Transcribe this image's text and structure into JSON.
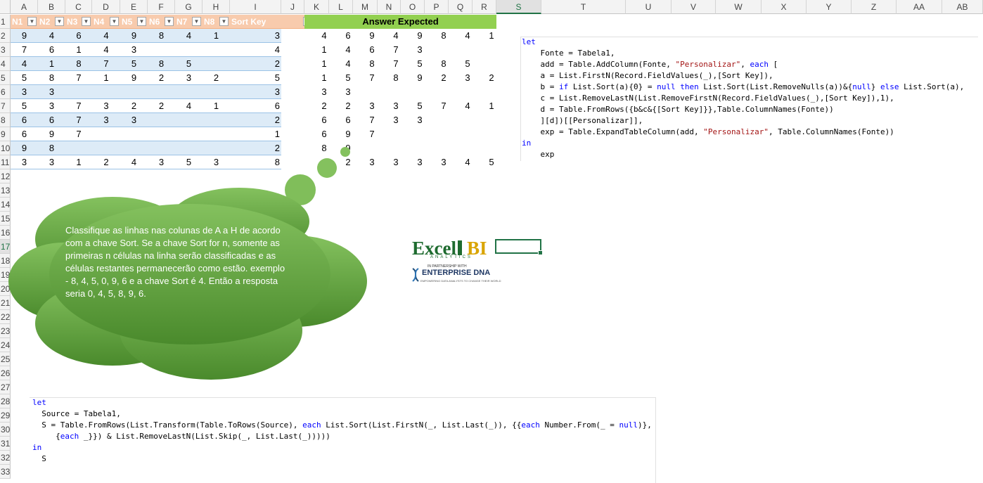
{
  "columns": [
    "A",
    "B",
    "C",
    "D",
    "E",
    "F",
    "G",
    "H",
    "I",
    "J",
    "K",
    "L",
    "M",
    "N",
    "O",
    "P",
    "Q",
    "R",
    "S",
    "T",
    "U",
    "V",
    "W",
    "X",
    "Y",
    "Z",
    "AA",
    "AB"
  ],
  "rows": [
    "1",
    "2",
    "3",
    "4",
    "5",
    "6",
    "7",
    "8",
    "9",
    "10",
    "11",
    "12",
    "13",
    "14",
    "15",
    "16",
    "17",
    "18",
    "19",
    "20",
    "21",
    "22",
    "23",
    "24",
    "25",
    "26",
    "27",
    "28",
    "29",
    "30",
    "31",
    "32",
    "33"
  ],
  "table": {
    "headers": [
      "N1",
      "N2",
      "N3",
      "N4",
      "N5",
      "N6",
      "N7",
      "N8",
      "Sort Key"
    ],
    "rows": [
      [
        "9",
        "4",
        "6",
        "4",
        "9",
        "8",
        "4",
        "1",
        "3"
      ],
      [
        "7",
        "6",
        "1",
        "4",
        "3",
        "",
        "",
        "",
        "4"
      ],
      [
        "4",
        "1",
        "8",
        "7",
        "5",
        "8",
        "5",
        "",
        "2"
      ],
      [
        "5",
        "8",
        "7",
        "1",
        "9",
        "2",
        "3",
        "2",
        "5"
      ],
      [
        "3",
        "3",
        "",
        "",
        "",
        "",
        "",
        "",
        "3"
      ],
      [
        "5",
        "3",
        "7",
        "3",
        "2",
        "2",
        "4",
        "1",
        "6"
      ],
      [
        "6",
        "6",
        "7",
        "3",
        "3",
        "",
        "",
        "",
        "2"
      ],
      [
        "6",
        "9",
        "7",
        "",
        "",
        "",
        "",
        "",
        "1"
      ],
      [
        "9",
        "8",
        "",
        "",
        "",
        "",
        "",
        "",
        "2"
      ],
      [
        "3",
        "3",
        "1",
        "2",
        "4",
        "3",
        "5",
        "3",
        "8"
      ]
    ]
  },
  "answer": {
    "title": "Answer Expected",
    "rows": [
      [
        "4",
        "6",
        "9",
        "4",
        "9",
        "8",
        "4",
        "1"
      ],
      [
        "1",
        "4",
        "6",
        "7",
        "3",
        "",
        "",
        ""
      ],
      [
        "1",
        "4",
        "8",
        "7",
        "5",
        "8",
        "5",
        ""
      ],
      [
        "1",
        "5",
        "7",
        "8",
        "9",
        "2",
        "3",
        "2"
      ],
      [
        "3",
        "3",
        "",
        "",
        "",
        "",
        "",
        ""
      ],
      [
        "2",
        "2",
        "3",
        "3",
        "5",
        "7",
        "4",
        "1"
      ],
      [
        "6",
        "6",
        "7",
        "3",
        "3",
        "",
        "",
        ""
      ],
      [
        "6",
        "9",
        "7",
        "",
        "",
        "",
        "",
        ""
      ],
      [
        "8",
        "9",
        "",
        "",
        "",
        "",
        "",
        ""
      ],
      [
        "",
        "2",
        "3",
        "3",
        "3",
        "3",
        "4",
        "5"
      ]
    ]
  },
  "callout": {
    "text": "Classifique as linhas nas colunas de A a H de acordo com a chave Sort. Se a chave Sort for n, somente as primeiras n células na linha serão classificadas e as células restantes permanecerão como estão. exemplo - 8, 4, 5, 0, 9, 6 e a chave Sort é 4. Então a resposta seria 0, 4, 5, 8, 9, 6.",
    "color": "#70ad47"
  },
  "logo": {
    "name": "ExcelBI",
    "sub": "ANALYTICS",
    "partner_line": "IN PARTNERSHIP WITH",
    "partner": "ENTERPRISE DNA",
    "tagline": "EMPOWERING DATA ANALYSTS TO CHANGE THEIR WORLD"
  },
  "code_right": [
    "let",
    "    Fonte = Tabela1,",
    "    add = Table.AddColumn(Fonte, \"Personalizar\", each [",
    "    a = List.FirstN(Record.FieldValues(_),[Sort Key]),",
    "    b = if List.Sort(a){0} = null then List.Sort(List.RemoveNulls(a))&{null} else List.Sort(a),",
    "    c = List.RemoveLastN(List.RemoveFirstN(Record.FieldValues(_),[Sort Key]),1),",
    "    d = Table.FromRows({b&c&{[Sort Key]}},Table.ColumnNames(Fonte))",
    "    ][d])[[Personalizar]],",
    "    exp = Table.ExpandTableColumn(add, \"Personalizar\", Table.ColumnNames(Fonte))",
    "in",
    "    exp"
  ],
  "code_bottom": [
    "let",
    "  Source = Tabela1,",
    "  S = Table.FromRows(List.Transform(Table.ToRows(Source), each List.Sort(List.FirstN(_, List.Last(_)), {{each Number.From(_ = null)},",
    "     {each _}}) & List.RemoveLastN(List.Skip(_, List.Last(_)))))",
    "in",
    "  S"
  ]
}
